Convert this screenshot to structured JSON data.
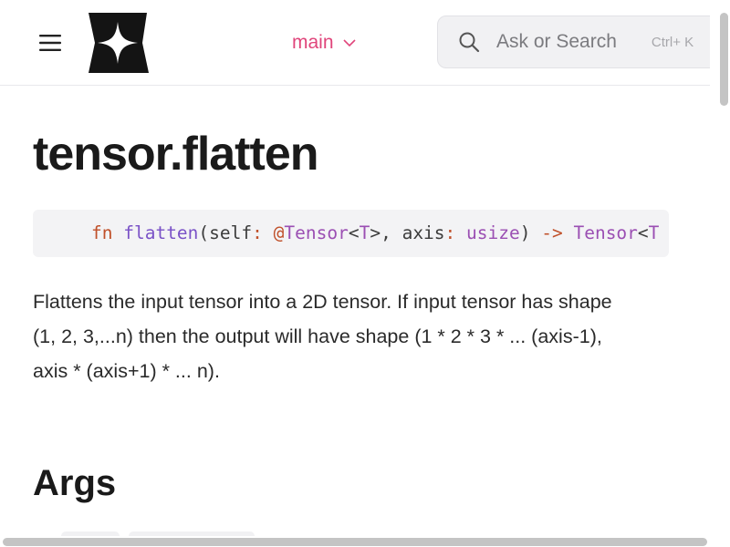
{
  "header": {
    "menu_icon": "hamburger-menu-icon",
    "logo_icon": "four-point-star-logo",
    "version": {
      "label": "main",
      "icon": "chevron-down-icon",
      "accent_color": "#e0457b"
    },
    "search": {
      "icon": "search-icon",
      "placeholder": "Ask or Search",
      "shortcut": "Ctrl+ K"
    }
  },
  "main": {
    "title": "tensor.flatten",
    "code": {
      "kw_fn": "fn",
      "fn_name": "flatten",
      "open_paren": "(",
      "param_self": "self",
      "colon1": ":",
      "at": "@",
      "type_tensor": "Tensor",
      "lt": "<",
      "type_t": "T",
      "gt_comma": ">, ",
      "param_axis": "axis",
      "colon2": ":",
      "type_usize": "usize",
      "close_paren": ") ",
      "arrow": "->",
      "ret_tensor": "Tensor",
      "ret_lt": "<",
      "ret_t": "T"
    },
    "description": "Flattens the input tensor into a 2D tensor. If input tensor has shape (1, 2, 3,...n) then the output will have shape (1 * 2 * 3 * ... (axis-1), axis * (axis+1) * ... n).",
    "args_heading": "Args"
  }
}
